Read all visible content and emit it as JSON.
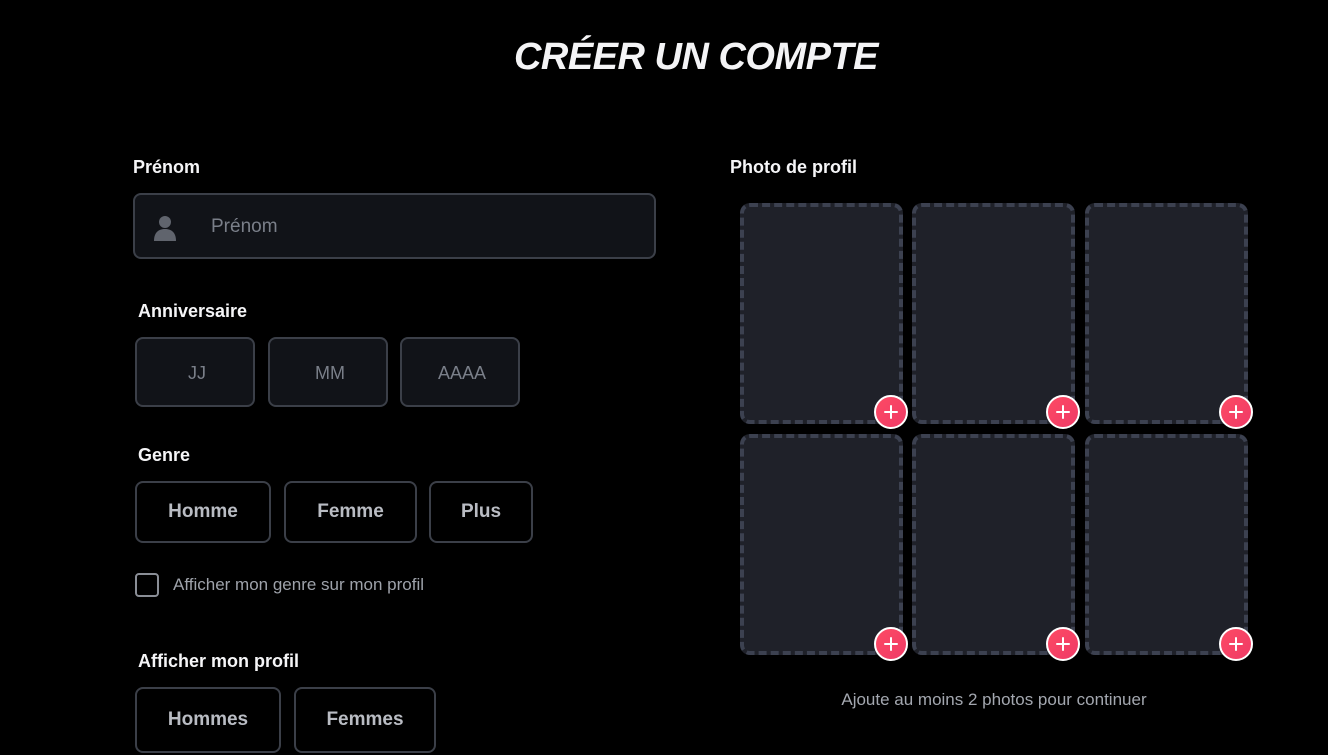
{
  "page": {
    "title": "CRÉER UN COMPTE"
  },
  "first_name": {
    "label": "Prénom",
    "placeholder": "Prénom",
    "value": "",
    "icon": "user-icon"
  },
  "birthday": {
    "label": "Anniversaire",
    "day_placeholder": "JJ",
    "month_placeholder": "MM",
    "year_placeholder": "AAAA"
  },
  "gender": {
    "label": "Genre",
    "options": [
      "Homme",
      "Femme",
      "Plus"
    ],
    "show_on_profile_label": "Afficher mon genre sur mon profil",
    "show_on_profile_checked": false
  },
  "show_me": {
    "label": "Afficher mon profil",
    "options": [
      "Hommes",
      "Femmes"
    ]
  },
  "photos": {
    "label": "Photo de profil",
    "slot_count": 6,
    "add_icon": "plus-icon",
    "hint": "Ajoute au moins 2 photos pour continuer"
  },
  "colors": {
    "background": "#000000",
    "accent": "#fd4a64",
    "field_border": "#3b3f48",
    "photo_slot": "#1f2129"
  }
}
